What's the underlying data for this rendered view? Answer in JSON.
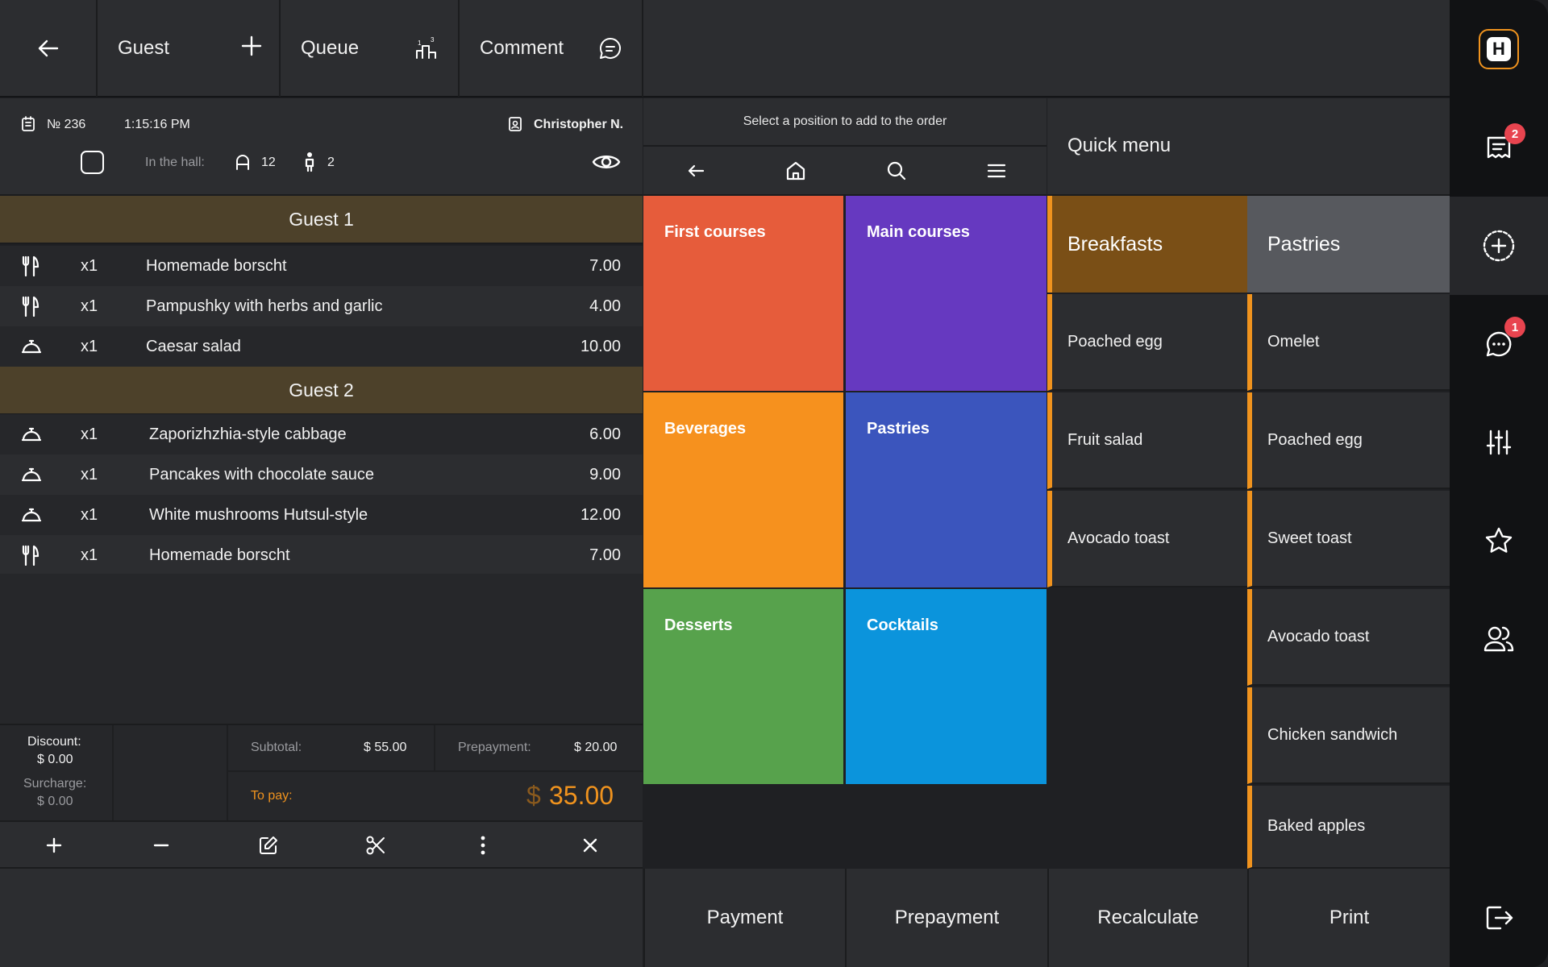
{
  "topbar": {
    "guest_label": "Guest",
    "queue_label": "Queue",
    "comment_label": "Comment"
  },
  "order": {
    "number": "№ 236",
    "time": "1:15:16 PM",
    "waiter": "Christopher N.",
    "hall_label": "In the hall:",
    "table": "12",
    "guests_count": "2"
  },
  "guests": [
    {
      "title": "Guest 1",
      "items": [
        {
          "icon": "fork-knife-icon",
          "qty": "x1",
          "name": "Homemade borscht",
          "price": "7.00"
        },
        {
          "icon": "fork-knife-icon",
          "qty": "x1",
          "name": "Pampushky with herbs and garlic",
          "price": "4.00"
        },
        {
          "icon": "cloche-icon",
          "qty": "x1",
          "name": "Caesar salad",
          "price": "10.00"
        }
      ]
    },
    {
      "title": "Guest  2",
      "items": [
        {
          "icon": "cloche-icon",
          "qty": "x1",
          "name": "Zaporizhzhia-style cabbage",
          "price": "6.00"
        },
        {
          "icon": "cloche-icon",
          "qty": "x1",
          "name": "Pancakes with chocolate sauce",
          "price": "9.00"
        },
        {
          "icon": "cloche-icon",
          "qty": "x1",
          "name": "White mushrooms Hutsul-style",
          "price": "12.00"
        },
        {
          "icon": "fork-knife-icon",
          "qty": "x1",
          "name": "Homemade borscht",
          "price": "7.00"
        }
      ]
    }
  ],
  "summary": {
    "discount_label": "Discount:",
    "discount_value": "$ 0.00",
    "surcharge_label": "Surcharge:",
    "surcharge_value": "$ 0.00",
    "subtotal_label": "Subtotal:",
    "subtotal_value": "$ 55.00",
    "prepayment_label": "Prepayment:",
    "prepayment_value": "$ 20.00",
    "topay_label": "To pay:",
    "topay_currency": "$",
    "topay_value": "35.00"
  },
  "menu": {
    "hint": "Select a position to add to the order",
    "categories": [
      {
        "label": "First courses",
        "color": "#e65c3b"
      },
      {
        "label": "Main courses",
        "color": "#6639c0"
      },
      {
        "label": "Beverages",
        "color": "#f6911e"
      },
      {
        "label": "Pastries",
        "color": "#3b55bd"
      },
      {
        "label": "Desserts",
        "color": "#57a24c"
      },
      {
        "label": "Cocktails",
        "color": "#0b94dc"
      }
    ]
  },
  "quick_menu": {
    "title": "Quick menu",
    "breakfasts": {
      "title": "Breakfasts",
      "items": [
        "Poached egg",
        "Fruit salad",
        "Avocado toast"
      ]
    },
    "pastries": {
      "title": "Pastries",
      "items": [
        "Omelet",
        "Poached egg",
        "Sweet toast",
        "Avocado toast",
        "Chicken sandwich",
        "Baked apples"
      ]
    }
  },
  "bottom_buttons": {
    "payment": "Payment",
    "prepayment": "Prepayment",
    "recalculate": "Recalculate",
    "print": "Print"
  },
  "rail": {
    "logo_letter": "H",
    "orders_badge": "2",
    "messages_badge": "1"
  },
  "colors": {
    "accent": "#f0931e",
    "guest_header": "#4d412a",
    "breakfasts_header": "#7a4f16",
    "pastries_header": "#57595e",
    "badge": "#e8444f"
  }
}
